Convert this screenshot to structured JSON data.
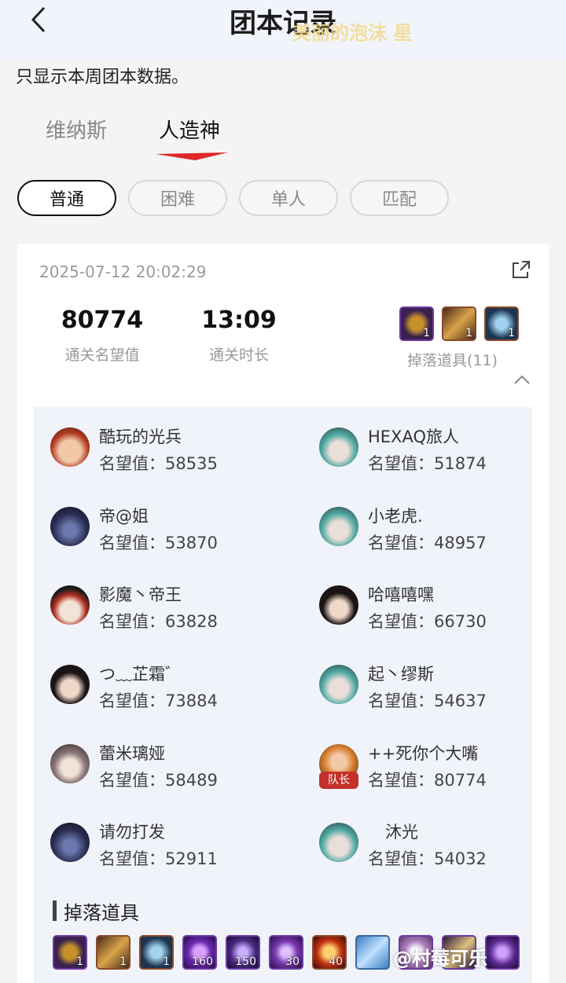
{
  "header": {
    "title": "团本记录",
    "overlay_text": "美丽的泡沫 星"
  },
  "notice": "只显示本周团本数据。",
  "tabs": [
    {
      "label": "维纳斯",
      "active": false
    },
    {
      "label": "人造神",
      "active": true
    }
  ],
  "filters": [
    {
      "label": "普通",
      "active": true
    },
    {
      "label": "困难",
      "active": false
    },
    {
      "label": "单人",
      "active": false
    },
    {
      "label": "匹配",
      "active": false
    }
  ],
  "record": {
    "timestamp": "2025-07-12 20:02:29",
    "fame_value": "80774",
    "fame_label": "通关名望值",
    "duration_value": "13:09",
    "duration_label": "通关时长",
    "drops_label": "掉落道具(11)",
    "summary_drops": [
      {
        "icon": "ring-icon",
        "count": "1"
      },
      {
        "icon": "weapon-icon",
        "count": "1"
      },
      {
        "icon": "orb-icon",
        "count": "1"
      }
    ]
  },
  "score_prefix": "名望值：",
  "members": [
    {
      "name": "酷玩的光兵",
      "score": "58535",
      "avatar": "red-hair-avatar",
      "leader": false
    },
    {
      "name": "HEXAQ旅人",
      "score": "51874",
      "avatar": "teal-hair-avatar",
      "leader": false
    },
    {
      "name": "帝@姐",
      "score": "53870",
      "avatar": "dark-mage-avatar",
      "leader": false
    },
    {
      "name": "小老虎.",
      "score": "48957",
      "avatar": "teal-hair-avatar",
      "leader": false
    },
    {
      "name": "影魔丶帝王",
      "score": "63828",
      "avatar": "hat-avatar",
      "leader": false
    },
    {
      "name": "哈嘻嘻嘿",
      "score": "66730",
      "avatar": "black-hair-avatar",
      "leader": false
    },
    {
      "name": "つ﹏芷霜゛",
      "score": "73884",
      "avatar": "black-hair-avatar",
      "leader": false
    },
    {
      "name": "起丶缪斯",
      "score": "54637",
      "avatar": "teal-hair-avatar",
      "leader": false
    },
    {
      "name": "蕾米璃娅",
      "score": "58489",
      "avatar": "silver-hair-avatar",
      "leader": false
    },
    {
      "name": "++死你个大嘴",
      "score": "80774",
      "avatar": "orange-hair-avatar",
      "leader": true,
      "leader_label": "队长"
    },
    {
      "name": "请勿打发",
      "score": "52911",
      "avatar": "dark-mage-avatar",
      "leader": false
    },
    {
      "name": "沐光",
      "score": "54032",
      "avatar": "teal-hair-avatar",
      "leader": false
    }
  ],
  "drops_section": {
    "title": "掉落道具",
    "items": [
      {
        "icon": "ring-icon",
        "count": "1",
        "color": "#3a2150"
      },
      {
        "icon": "weapon-icon",
        "count": "1",
        "color": "#4a2a1a"
      },
      {
        "icon": "orb-icon",
        "count": "1",
        "color": "#1d3550"
      },
      {
        "icon": "purple-orb-icon",
        "count": "160",
        "color": "#3a1a60"
      },
      {
        "icon": "crystal-icon",
        "count": "150",
        "color": "#2a1a4a"
      },
      {
        "icon": "purple-stone-icon",
        "count": "30",
        "color": "#3b1d5c"
      },
      {
        "icon": "fire-ring-icon",
        "count": "40",
        "color": "#5a1a1a"
      },
      {
        "icon": "scroll-icon",
        "count": "",
        "color": "#1a3a5a"
      },
      {
        "icon": "purple-ring-icon",
        "count": "",
        "color": "#5a3a6a"
      },
      {
        "icon": "gold-weapon-icon",
        "count": "",
        "color": "#2a1a3a"
      },
      {
        "icon": "purple-shard-icon",
        "count": "",
        "color": "#3a1a5a"
      }
    ]
  },
  "watermark": "@村莓可乐",
  "colors": {
    "accent": "#e0282a",
    "card_bg": "#ffffff",
    "members_bg": "#f0f3fa",
    "leader_badge": "#c4302b"
  }
}
